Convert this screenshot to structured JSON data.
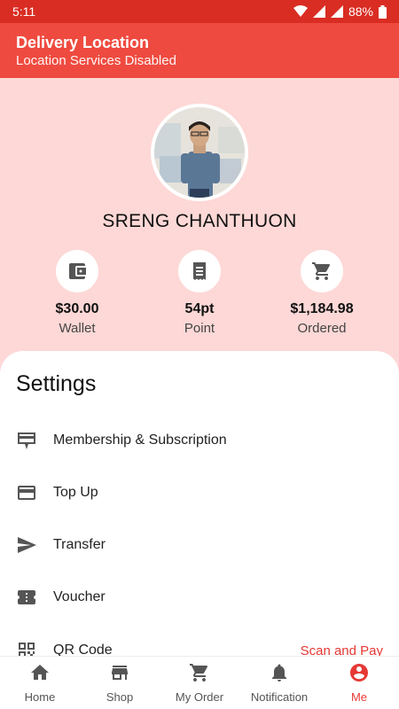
{
  "status_bar": {
    "time": "5:11",
    "battery": "88%"
  },
  "header": {
    "title": "Delivery Location",
    "subtitle": "Location Services Disabled"
  },
  "profile": {
    "name": "SRENG CHANTHUON",
    "stats": [
      {
        "icon": "wallet-icon",
        "value": "$30.00",
        "label": "Wallet"
      },
      {
        "icon": "receipt-icon",
        "value": "54pt",
        "label": "Point"
      },
      {
        "icon": "cart-icon",
        "value": "$1,184.98",
        "label": "Ordered"
      }
    ]
  },
  "settings": {
    "title": "Settings",
    "items": [
      {
        "icon": "membership-card-icon",
        "label": "Membership & Subscription"
      },
      {
        "icon": "credit-card-icon",
        "label": "Top Up"
      },
      {
        "icon": "send-icon",
        "label": "Transfer"
      },
      {
        "icon": "ticket-icon",
        "label": "Voucher"
      },
      {
        "icon": "qr-code-icon",
        "label": "QR Code",
        "extra": "Scan and Pay"
      }
    ]
  },
  "bottom_nav": {
    "items": [
      {
        "icon": "home-icon",
        "label": "Home"
      },
      {
        "icon": "store-icon",
        "label": "Shop"
      },
      {
        "icon": "cart-icon",
        "label": "My Order"
      },
      {
        "icon": "bell-icon",
        "label": "Notification"
      },
      {
        "icon": "account-icon",
        "label": "Me",
        "active": true
      }
    ]
  },
  "colors": {
    "primary": "#ef4a3f",
    "status_bar": "#d92d23",
    "profile_bg": "#fdd8d6",
    "accent_text": "#e53935"
  }
}
